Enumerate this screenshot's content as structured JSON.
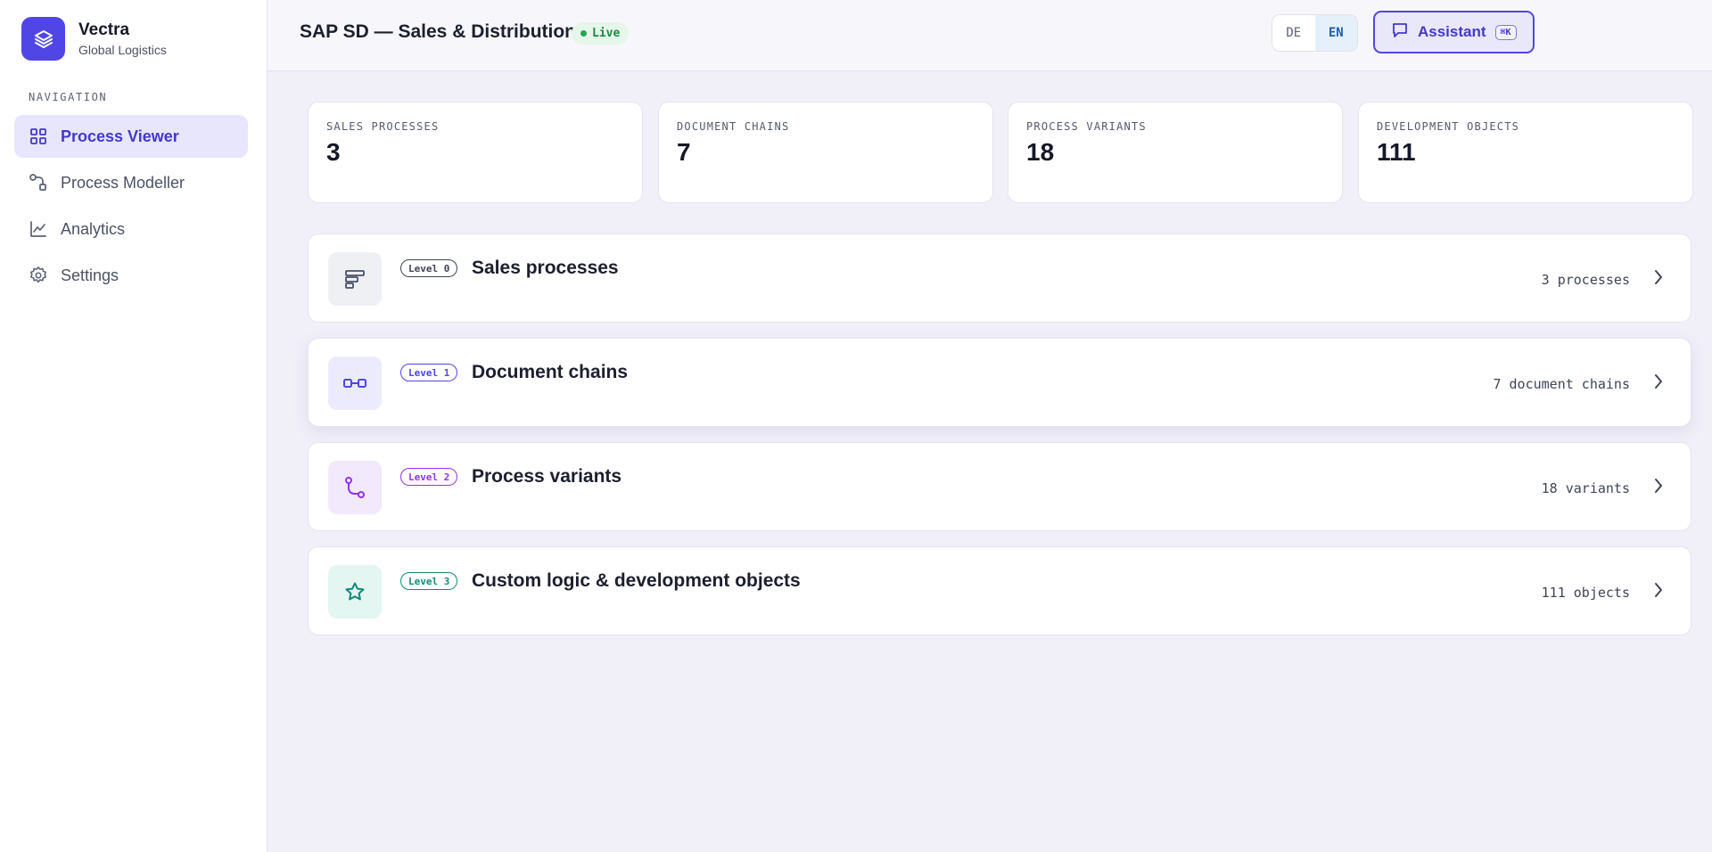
{
  "brand": {
    "name": "Vectra",
    "subtitle": "Global Logistics",
    "accent": "#4f46e5"
  },
  "navigation": {
    "heading": "NAVIGATION",
    "items": [
      {
        "label": "Process Viewer",
        "icon": "grid-icon",
        "active": true
      },
      {
        "label": "Process Modeller",
        "icon": "flow-shapes-icon",
        "active": false
      },
      {
        "label": "Analytics",
        "icon": "line-chart-icon",
        "active": false
      },
      {
        "label": "Settings",
        "icon": "gear-icon",
        "active": false
      }
    ]
  },
  "header": {
    "title": "SAP SD — Sales & Distribution",
    "status": "Live",
    "languages": [
      "DE",
      "EN"
    ],
    "selected_language": "EN",
    "assistant_label": "Assistant",
    "assistant_shortcut": "⌘K"
  },
  "stats": [
    {
      "label": "SALES PROCESSES",
      "value": "3"
    },
    {
      "label": "DOCUMENT CHAINS",
      "value": "7"
    },
    {
      "label": "PROCESS VARIANTS",
      "value": "18"
    },
    {
      "label": "DEVELOPMENT OBJECTS",
      "value": "111"
    }
  ],
  "levels": [
    {
      "badge": "Level 0",
      "title": "Sales processes",
      "count": "3 processes",
      "icon": "bars-icon",
      "color": "#475066",
      "bg": "#eef0f4"
    },
    {
      "badge": "Level 1",
      "title": "Document chains",
      "count": "7 document chains",
      "icon": "link-chain-icon",
      "color": "#4f46e5",
      "bg": "#ecebfd"
    },
    {
      "badge": "Level 2",
      "title": "Process variants",
      "count": "18 variants",
      "icon": "branch-icon",
      "color": "#9333ea",
      "bg": "#f3e9fd"
    },
    {
      "badge": "Level 3",
      "title": "Custom logic & development objects",
      "count": "111 objects",
      "icon": "star-icon",
      "color": "#0f8a78",
      "bg": "#e3f6f1"
    }
  ]
}
